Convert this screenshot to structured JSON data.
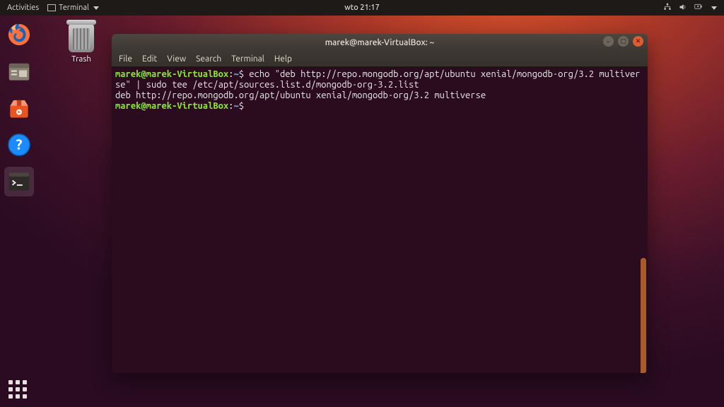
{
  "topbar": {
    "activities": "Activities",
    "app_indicator": "Terminal",
    "clock": "wto 21:17"
  },
  "desktop": {
    "trash_label": "Trash"
  },
  "window": {
    "title": "marek@marek-VirtualBox: ~",
    "menubar": [
      "File",
      "Edit",
      "View",
      "Search",
      "Terminal",
      "Help"
    ]
  },
  "terminal": {
    "user_host": "marek@marek-VirtualBox",
    "path": "~",
    "prompt_sep": ":",
    "prompt_sym": "$",
    "cmd1": "echo \"deb http://repo.mongodb.org/apt/ubuntu xenial/mongodb-org/3.2 multiverse\" | sudo tee /etc/apt/sources.list.d/mongodb-org-3.2.list",
    "out1": "deb http://repo.mongodb.org/apt/ubuntu xenial/mongodb-org/3.2 multiverse",
    "cmd2": ""
  }
}
